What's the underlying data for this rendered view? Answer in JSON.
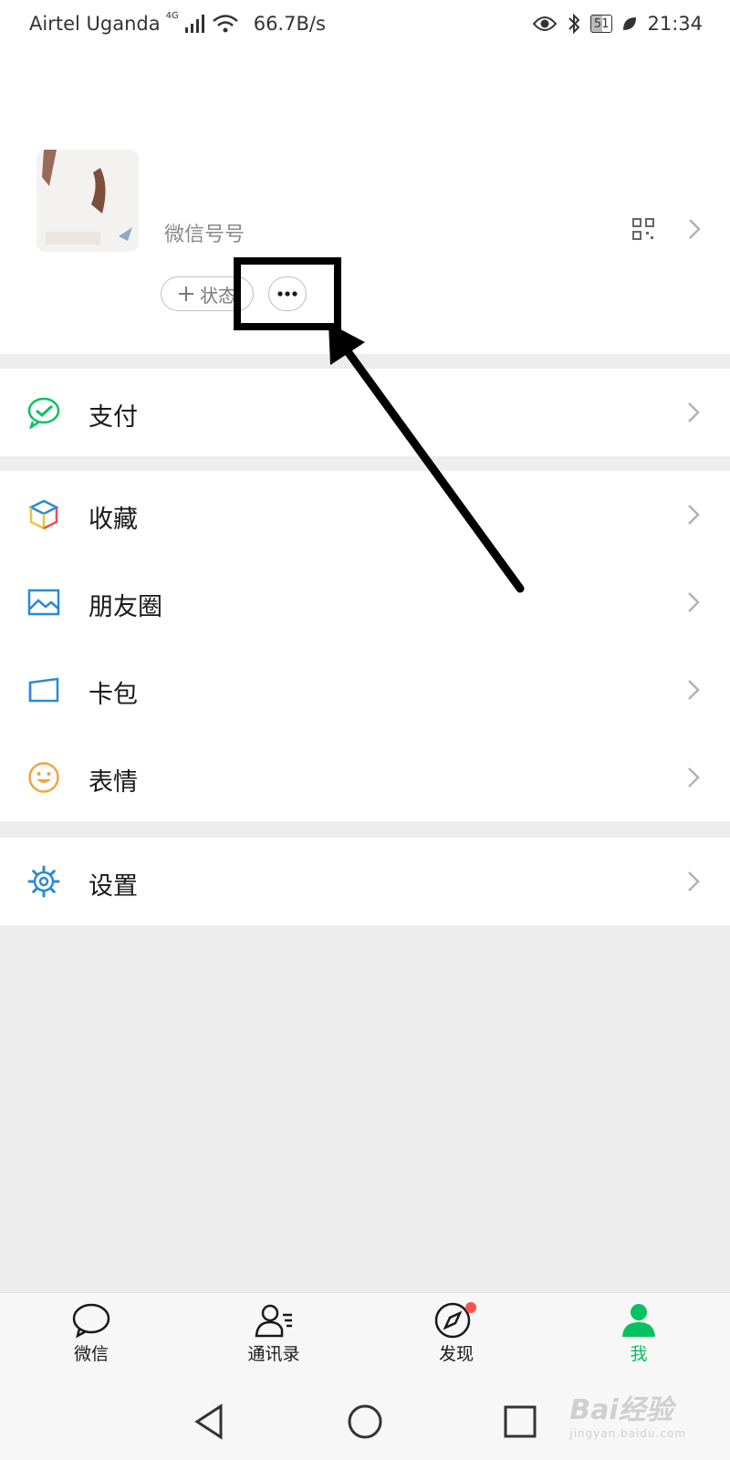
{
  "status_bar": {
    "carrier": "Airtel Uganda",
    "network": "4G",
    "speed": "66.7B/s",
    "battery": "51",
    "time": "21:34"
  },
  "profile": {
    "wechat_id_label": "微信号号",
    "status_button": "状态",
    "more_button_icon": "more-icon"
  },
  "menu": {
    "pay": "支付",
    "favorites": "收藏",
    "moments": "朋友圈",
    "cards": "卡包",
    "stickers": "表情",
    "settings": "设置"
  },
  "tabbar": {
    "chats": "微信",
    "contacts": "通讯录",
    "discover": "发现",
    "me": "我"
  },
  "watermark": {
    "brand": "Bai经验",
    "url": "jingyan.baidu.com"
  },
  "colors": {
    "wechat_green": "#07c160",
    "active_tab": "#07c160",
    "badge_red": "#fa5151",
    "icon_blue": "#2a8ad4",
    "sticker_orange": "#f0a442"
  }
}
